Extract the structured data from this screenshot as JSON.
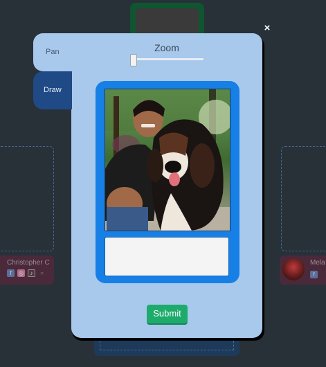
{
  "modal": {
    "tabs": {
      "pan": "Pan",
      "draw": "Draw"
    },
    "close_icon": "×",
    "zoom": {
      "label": "Zoom",
      "value_fraction": 0.0
    },
    "caption": "",
    "submit_label": "Submit"
  },
  "background": {
    "left_user": {
      "name": "Christopher C",
      "icons": [
        "facebook-icon",
        "instagram-icon",
        "tiktok-icon",
        "youtube-icon"
      ]
    },
    "right_user": {
      "name": "Mela",
      "icons": [
        "facebook-icon"
      ]
    }
  },
  "colors": {
    "page_bg": "#283038",
    "modal_bg": "#a8c8ec",
    "draw_tab": "#1f4a86",
    "card_blue": "#1780e6",
    "submit_green": "#1dab6c"
  }
}
